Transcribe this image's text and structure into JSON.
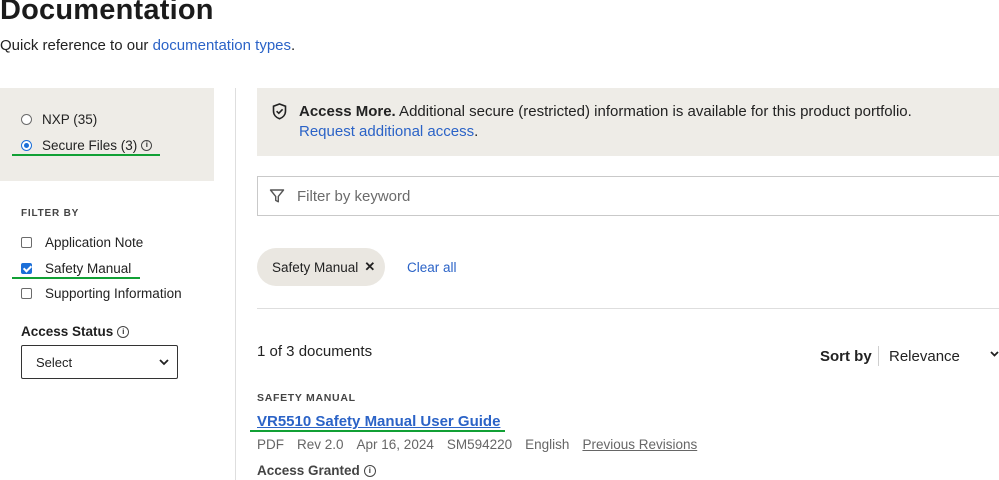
{
  "header": {
    "title": "Documentation",
    "subtitle_prefix": "Quick reference to our ",
    "subtitle_link": "documentation types",
    "subtitle_suffix": "."
  },
  "sources": [
    {
      "label": "NXP (35)",
      "selected": false
    },
    {
      "label": "Secure Files (3)",
      "selected": true,
      "info_icon": "info-icon"
    }
  ],
  "filters": {
    "heading": "FILTER BY",
    "items": [
      {
        "label": "Application Note",
        "checked": false
      },
      {
        "label": "Safety Manual",
        "checked": true
      },
      {
        "label": "Supporting Information",
        "checked": false
      }
    ],
    "access_status": {
      "label": "Access Status",
      "selected": "Select"
    }
  },
  "banner": {
    "icon": "shield-check-icon",
    "bold": "Access More.",
    "text": " Additional secure (restricted) information is available for this product portfolio.",
    "link": "Request additional access",
    "link_suffix": "."
  },
  "search": {
    "placeholder": "Filter by keyword",
    "icon": "funnel-icon"
  },
  "active_filters": {
    "chips": [
      {
        "label": "Safety Manual"
      }
    ],
    "clear_all": "Clear all"
  },
  "results": {
    "count_text": "1 of 3 documents",
    "sort_label": "Sort by",
    "sort_value": "Relevance"
  },
  "documents": [
    {
      "category": "SAFETY MANUAL",
      "title": "VR5510 Safety Manual User Guide",
      "format": "PDF",
      "revision": "Rev 2.0",
      "date": "Apr 16, 2024",
      "id": "SM594220",
      "language": "English",
      "revisions_link": "Previous Revisions",
      "access": "Access Granted"
    }
  ],
  "colors": {
    "link": "#2b63c7",
    "panel_bg": "#eeece7",
    "accent_blue": "#1c6fd8",
    "annotation_green": "#11a035"
  }
}
